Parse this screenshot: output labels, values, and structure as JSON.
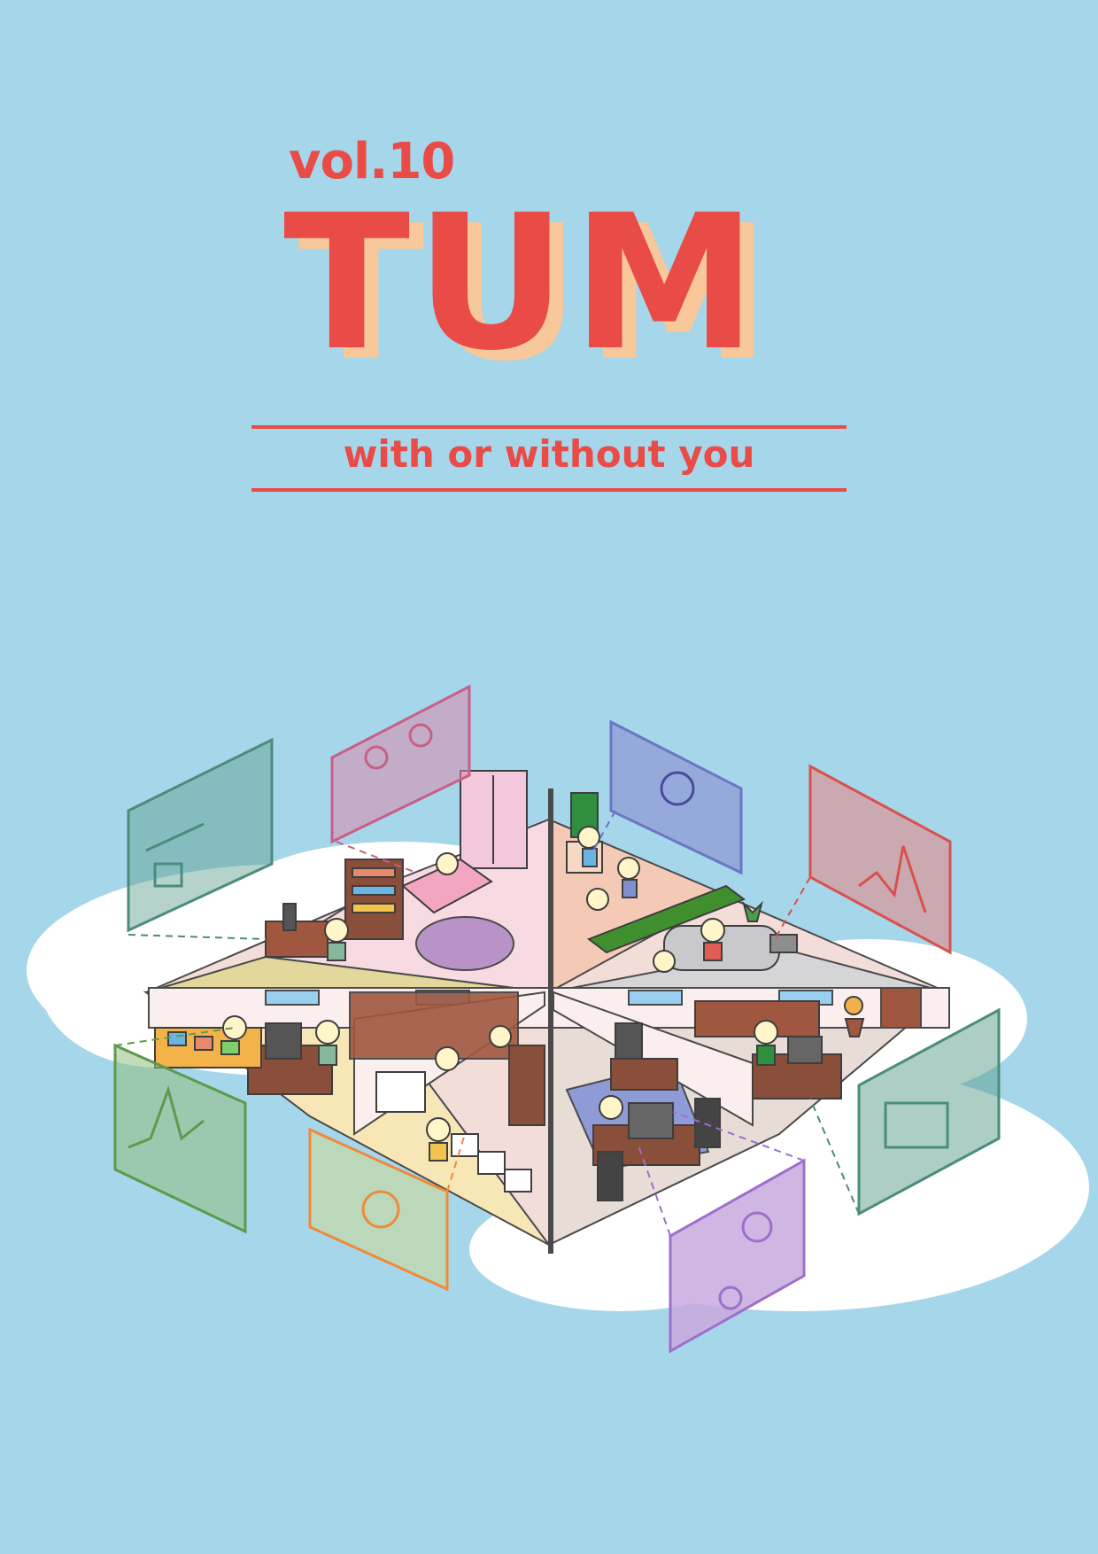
{
  "cover": {
    "volume": "vol.10",
    "title": "TUM",
    "subtitle": "with or without you"
  },
  "colors": {
    "background": "#a6d6ea",
    "title": "#e94b47",
    "title_shadow": "#f8c79a",
    "cloud": "#ffffff"
  },
  "illustration": {
    "panels": [
      "teal-screen",
      "pink-screen",
      "blue-screen",
      "red-screen",
      "green-screen",
      "orange-screen",
      "purple-screen",
      "green-screen-right"
    ]
  }
}
